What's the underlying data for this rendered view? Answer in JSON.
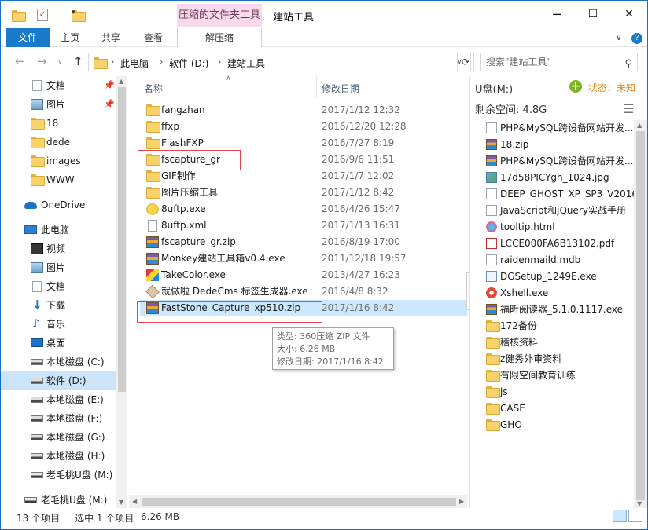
{
  "titlebar": {
    "context_tab": "压缩的文件夹工具",
    "title": "建站工具",
    "minimize": "─",
    "maximize": "☐",
    "close": "✕"
  },
  "ribbon": {
    "tabs": [
      "文件",
      "主页",
      "共享",
      "查看",
      "解压缩"
    ],
    "collapse": "∨",
    "help": "?"
  },
  "address": {
    "crumbs": [
      "此电脑",
      "软件 (D:)",
      "建站工具"
    ],
    "search_placeholder": "搜索\"建站工具\""
  },
  "columns": {
    "name": "名称",
    "date": "修改日期"
  },
  "nav": {
    "items": [
      {
        "label": "文档",
        "icon": "document-icon",
        "pinned": true
      },
      {
        "label": "图片",
        "icon": "pictures-icon",
        "pinned": true
      },
      {
        "label": "18",
        "icon": "folder-icon"
      },
      {
        "label": "dede",
        "icon": "folder-icon"
      },
      {
        "label": "images",
        "icon": "folder-icon"
      },
      {
        "label": "WWW",
        "icon": "folder-icon"
      },
      {
        "label": "OneDrive",
        "icon": "onedrive-icon"
      },
      {
        "label": "此电脑",
        "icon": "computer-icon"
      },
      {
        "label": "视频",
        "icon": "video-icon"
      },
      {
        "label": "图片",
        "icon": "pictures-icon"
      },
      {
        "label": "文档",
        "icon": "document-icon"
      },
      {
        "label": "下载",
        "icon": "download-icon"
      },
      {
        "label": "音乐",
        "icon": "music-icon"
      },
      {
        "label": "桌面",
        "icon": "desktop-icon"
      },
      {
        "label": "本地磁盘 (C:)",
        "icon": "drive-icon"
      },
      {
        "label": "软件 (D:)",
        "icon": "drive-icon",
        "selected": true
      },
      {
        "label": "本地磁盘 (E:)",
        "icon": "drive-icon"
      },
      {
        "label": "本地磁盘 (F:)",
        "icon": "drive-icon"
      },
      {
        "label": "本地磁盘 (G:)",
        "icon": "drive-icon"
      },
      {
        "label": "本地磁盘 (H:)",
        "icon": "drive-icon"
      },
      {
        "label": "老毛桃U盘 (M:)",
        "icon": "usb-drive-icon"
      },
      {
        "label": "老毛桃U盘 (M:)",
        "icon": "usb-drive-icon"
      }
    ]
  },
  "files": [
    {
      "name": "fangzhan",
      "date": "2017/1/12 12:32",
      "icon": "folder-icon"
    },
    {
      "name": "ffxp",
      "date": "2016/12/20 12:28",
      "icon": "folder-icon"
    },
    {
      "name": "FlashFXP",
      "date": "2016/7/27 8:19",
      "icon": "folder-icon"
    },
    {
      "name": "fscapture_gr",
      "date": "2016/9/6 11:51",
      "icon": "folder-icon",
      "highlighted": true
    },
    {
      "name": "GIF制作",
      "date": "2017/1/7 12:02",
      "icon": "folder-icon"
    },
    {
      "name": "图片压缩工具",
      "date": "2017/1/12 8:42",
      "icon": "folder-icon"
    },
    {
      "name": "8uftp.exe",
      "date": "2016/4/26 15:47",
      "icon": "ftp-app-icon"
    },
    {
      "name": "8uftp.xml",
      "date": "2017/1/13 16:31",
      "icon": "xml-file-icon"
    },
    {
      "name": "fscapture_gr.zip",
      "date": "2016/8/19 17:00",
      "icon": "zip-archive-icon"
    },
    {
      "name": "Monkey建站工具箱v0.4.exe",
      "date": "2011/12/18 19:57",
      "icon": "zip-archive-icon"
    },
    {
      "name": "TakeColor.exe",
      "date": "2013/4/27 16:23",
      "icon": "color-picker-icon"
    },
    {
      "name": "就做啦 DedeCms 标签生成器.exe",
      "date": "2016/4/8 8:32",
      "icon": "app-icon"
    },
    {
      "name": "FastStone_Capture_xp510.zip",
      "date": "2017/1/16 8:42",
      "icon": "zip-archive-icon",
      "selected": true,
      "highlighted": true
    }
  ],
  "tooltip": {
    "type": "类型: 360压缩 ZIP 文件",
    "size": "大小: 6.26 MB",
    "date": "修改日期: 2017/1/16 8:42"
  },
  "preview": {
    "title": "U盘(M:)",
    "status_label": "状态：",
    "status_value": "未知",
    "free": "剩余空间: 4.8G",
    "items": [
      {
        "label": "PHP&MySQL跨设备网站开发...",
        "icon": "doc-icon"
      },
      {
        "label": "18.zip",
        "icon": "zip-icon"
      },
      {
        "label": "PHP&MySQL跨设备网站开发...",
        "icon": "zip-icon"
      },
      {
        "label": "17d58PICYgh_1024.jpg",
        "icon": "image-icon"
      },
      {
        "label": "DEEP_GHOST_XP_SP3_V2016...",
        "icon": "doc-icon"
      },
      {
        "label": "JavaScript和jQuery实战手册",
        "icon": "doc-icon"
      },
      {
        "label": "tooltip.html",
        "icon": "web-icon"
      },
      {
        "label": "LCCE000FA6B13102.pdf",
        "icon": "pdf-icon"
      },
      {
        "label": "raidenmaild.mdb",
        "icon": "doc-icon"
      },
      {
        "label": "DGSetup_1249E.exe",
        "icon": "exe-icon"
      },
      {
        "label": "Xshell.exe",
        "icon": "xshell-icon"
      },
      {
        "label": "福昕阅读器_5.1.0.1117.exe",
        "icon": "zip-icon"
      },
      {
        "label": "172备份",
        "icon": "folder-icon"
      },
      {
        "label": "稽核资料",
        "icon": "folder-icon"
      },
      {
        "label": "z健秀外审资料",
        "icon": "folder-icon"
      },
      {
        "label": "有限空间教育训练",
        "icon": "folder-icon"
      },
      {
        "label": "js",
        "icon": "folder-icon"
      },
      {
        "label": "CASE",
        "icon": "folder-icon"
      },
      {
        "label": "GHO",
        "icon": "folder-icon"
      }
    ]
  },
  "status": {
    "count": "13 个项目",
    "selected": "选中 1 个项目",
    "size": "6.26 MB"
  }
}
